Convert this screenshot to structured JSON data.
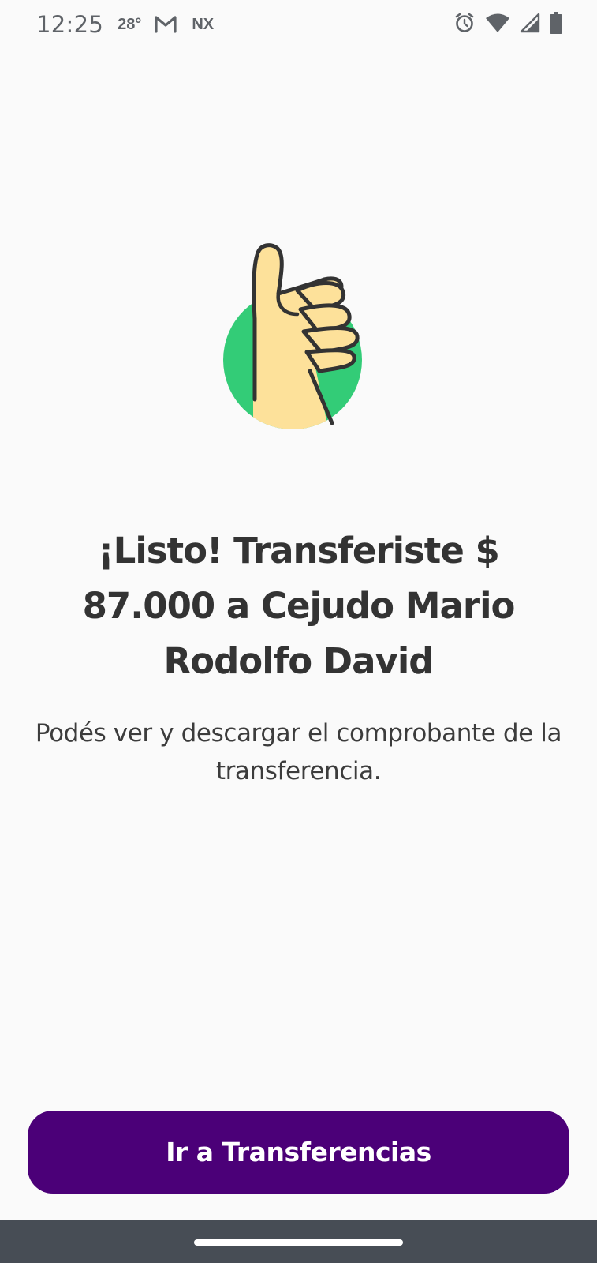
{
  "status_bar": {
    "time": "12:25",
    "temperature": "28°",
    "carrier_badge": "NX",
    "icons": [
      "gmail-icon",
      "alarm-icon",
      "wifi-icon",
      "cell-signal-icon",
      "battery-icon"
    ]
  },
  "confirmation": {
    "illustration": "thumbs-up-icon",
    "title": "¡Listo! Transferiste $ 87.000 a Cejudo Mario Rodolfo David",
    "subtitle": "Podés ver y descargar el comprobante de la transferencia."
  },
  "actions": {
    "primary_label": "Ir a Transferencias"
  },
  "colors": {
    "primary": "#4b0078",
    "accent_green": "#33cc77",
    "hand_fill": "#fde19a",
    "text_dark": "#333333",
    "nav_bar": "#474d55"
  }
}
